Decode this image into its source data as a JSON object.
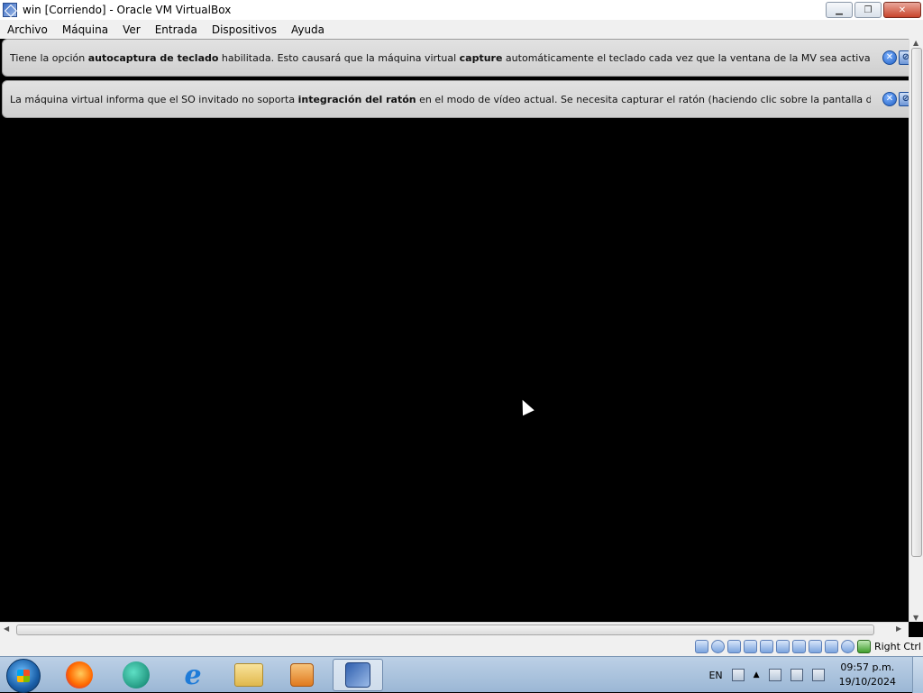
{
  "window": {
    "title": "win [Corriendo] - Oracle VM VirtualBox",
    "controls": [
      "minimize",
      "restore",
      "close"
    ]
  },
  "menu": {
    "items": [
      "Archivo",
      "Máquina",
      "Ver",
      "Entrada",
      "Dispositivos",
      "Ayuda"
    ]
  },
  "banners": [
    {
      "prefix": "Tiene la opción ",
      "bold1": "autocaptura de teclado",
      "mid1": " habilitada. Esto causará que la máquina virtual ",
      "bold2": "capture",
      "suffix": " automáticamente el teclado cada vez que la ventana de la MV sea activada y hará que no esté"
    },
    {
      "prefix": "La máquina virtual informa que el SO invitado no soporta ",
      "bold1": "integración del ratón",
      "mid1": " en el modo de vídeo actual. Se necesita capturar el ratón (haciendo clic sobre la pantalla de la máquina virtual o",
      "bold2": "",
      "suffix": ""
    }
  ],
  "statusbar": {
    "host_key": "Right Ctrl",
    "icons": [
      "hard-disk-icon",
      "optical-drive-icon",
      "audio-icon",
      "network-icon",
      "usb-icon",
      "shared-folders-icon",
      "display-icon",
      "video-capture-icon",
      "cpu-icon",
      "mouse-icon",
      "keyboard-icon"
    ]
  },
  "taskbar": {
    "apps": [
      "Firefox",
      "Microsoft Edge",
      "Internet Explorer",
      "Explorador de archivos",
      "Reproductor multimedia",
      "Oracle VM VirtualBox"
    ],
    "active_app": "Oracle VM VirtualBox"
  },
  "tray": {
    "language": "EN",
    "time": "09:57 p.m.",
    "date": "19/10/2024"
  }
}
